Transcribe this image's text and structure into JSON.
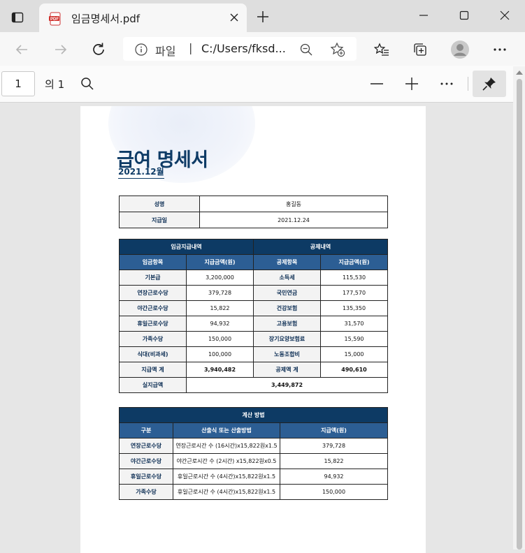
{
  "browser": {
    "tab_title": "임금명세서.pdf",
    "address_scheme": "파일",
    "address_url": "C:/Users/fksd..."
  },
  "pdf_toolbar": {
    "page_number": "1",
    "page_count": "의 1"
  },
  "document": {
    "title": "급여 명세서",
    "period": "2021.12월",
    "info": [
      {
        "label": "성명",
        "value": "홍길동"
      },
      {
        "label": "지급일",
        "value": "2021.12.24"
      }
    ],
    "pay": {
      "header_left": "임금지급내역",
      "header_right": "공제내역",
      "columns": [
        "임금항목",
        "지급금액(원)",
        "공제항목",
        "지급금액(원)"
      ],
      "rows": [
        [
          "기본급",
          "3,200,000",
          "소득세",
          "115,530"
        ],
        [
          "연장근로수당",
          "379,728",
          "국민연금",
          "177,570"
        ],
        [
          "야간근로수당",
          "15,822",
          "건강보험",
          "135,350"
        ],
        [
          "휴일근로수당",
          "94,932",
          "고용보험",
          "31,570"
        ],
        [
          "가족수당",
          "150,000",
          "장기요양보험료",
          "15,590"
        ],
        [
          "식대(비과세)",
          "100,000",
          "노동조합비",
          "15,000"
        ]
      ],
      "total_label": "지급액 계",
      "total_value": "3,940,482",
      "deduct_total_label": "공제액 계",
      "deduct_total_value": "490,610",
      "net_label": "실지급액",
      "net_value": "3,449,872"
    },
    "calc": {
      "header": "계산 방법",
      "columns": [
        "구분",
        "산출식 또는 산출방법",
        "지급액(원)"
      ],
      "rows": [
        [
          "연장근로수당",
          "연장근로시간 수 (16시간)x15,822원x1.5",
          "379,728"
        ],
        [
          "야간근로수당",
          "야간근로시간 수 (2시간) x15,822원x0.5",
          "15,822"
        ],
        [
          "휴일근로수당",
          "휴일근로시간 수 (4시간)x15,822원x1.5",
          "94,932"
        ],
        [
          "가족수당",
          "휴일근로시간 수 (4시간)x15,822원x1.5",
          "150,000"
        ]
      ]
    }
  }
}
